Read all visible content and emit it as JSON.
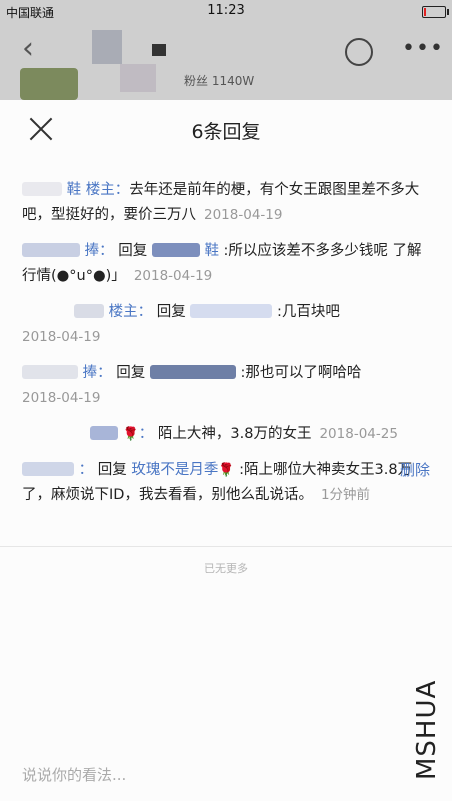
{
  "status_bar": {
    "carrier": "中国联通",
    "time": "11:23",
    "battery_level": 0.12,
    "battery_color": "#e02020"
  },
  "background_page": {
    "back_icon": "chevron-left-icon",
    "share_icon": "share-icon",
    "more_icon": "more-dots-icon",
    "more_text": "•••",
    "fans_text": "粉丝 1140W"
  },
  "sheet": {
    "title": "6条回复",
    "close_icon": "close-icon",
    "comments": [
      {
        "name": "鞋",
        "tag": "楼主",
        "reply_to": "",
        "text": "去年还是前年的梗，有个女王跟图里差不多大吧，型挺好的，要价三万八",
        "time": "2018-04-19"
      },
      {
        "name": "捧",
        "tag": "",
        "reply_to": "鞋",
        "text": ":所以应该差不多多少钱呢 了解行情(●°u°●)」",
        "time": "2018-04-19"
      },
      {
        "name": "",
        "tag": "楼主",
        "reply_to": "",
        "text": ":几百块吧",
        "time": "2018-04-19"
      },
      {
        "name": "捧",
        "tag": "",
        "reply_to": "",
        "text": ":那也可以了啊哈哈",
        "time": "2018-04-19"
      },
      {
        "name": "",
        "tag": "",
        "reply_to": "",
        "text": "陌上大神，3.8万的女王",
        "time": "2018-04-25"
      },
      {
        "name": "",
        "tag": "",
        "reply_to": "玫瑰不是月季",
        "text": ":陌上哪位大神卖女王3.8万了，麻烦说下ID，我去看看，别他么乱说话。",
        "time": "1分钟前"
      }
    ],
    "reply_word": "回复",
    "delete_label": "删除",
    "no_more": "已无更多",
    "input_placeholder": "说说你的看法...",
    "accent_color": "#4a76c4"
  },
  "watermark": "MSHUA"
}
